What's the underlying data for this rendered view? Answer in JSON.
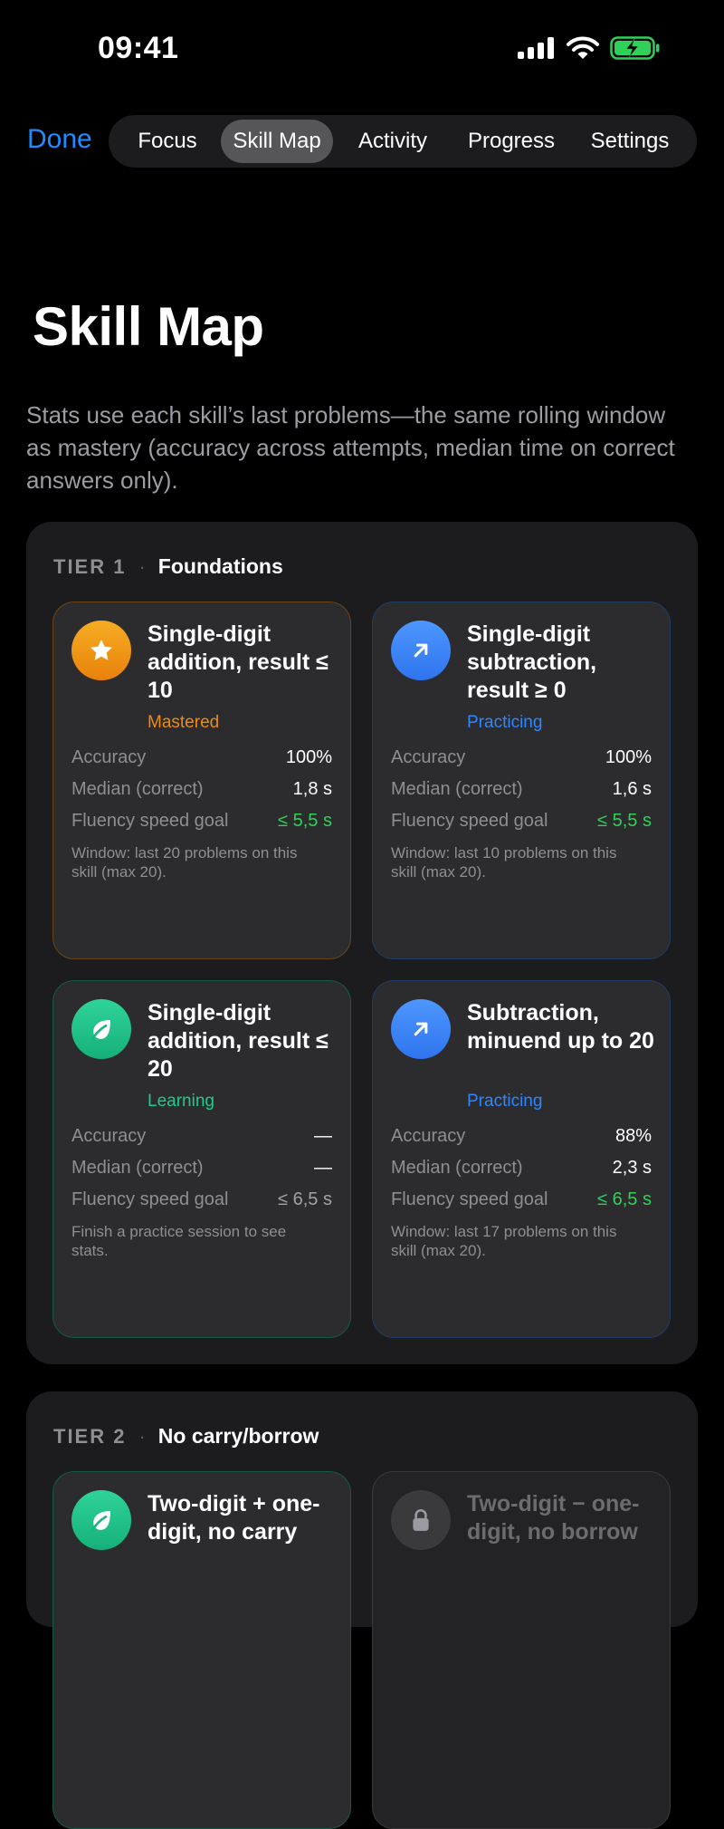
{
  "status_bar": {
    "time": "09:41"
  },
  "nav": {
    "done_label": "Done",
    "tabs": [
      {
        "label": "Focus",
        "active": false
      },
      {
        "label": "Skill Map",
        "active": true
      },
      {
        "label": "Activity",
        "active": false
      },
      {
        "label": "Progress",
        "active": false
      },
      {
        "label": "Settings",
        "active": false
      }
    ]
  },
  "page": {
    "title": "Skill Map",
    "intro": "Stats use each skill’s last problems—the same rolling window as mastery (accuracy across attempts, median time on correct answers only)."
  },
  "tiers": [
    {
      "label": "TIER 1",
      "separator": "·",
      "name": "Foundations",
      "skills": [
        {
          "title": "Single-digit addition, result ≤ 10",
          "status": "Mastered",
          "icon": "star-icon",
          "accuracy_label": "Accuracy",
          "accuracy": "100%",
          "median_label": "Median (correct)",
          "median": "1,8 s",
          "goal_label": "Fluency speed goal",
          "goal": "≤ 5,5 s",
          "note": "Window: last 20 problems on this skill (max 20)."
        },
        {
          "title": "Single-digit subtraction, result ≥ 0",
          "status": "Practicing",
          "icon": "arrow-up-right-icon",
          "accuracy_label": "Accuracy",
          "accuracy": "100%",
          "median_label": "Median (correct)",
          "median": "1,6 s",
          "goal_label": "Fluency speed goal",
          "goal": "≤ 5,5 s",
          "note": "Window: last 10 problems on this skill (max 20)."
        },
        {
          "title": "Single-digit addition, result ≤ 20",
          "status": "Learning",
          "icon": "leaf-icon",
          "accuracy_label": "Accuracy",
          "accuracy": "—",
          "median_label": "Median (correct)",
          "median": "—",
          "goal_label": "Fluency speed goal",
          "goal": "≤ 6,5 s",
          "note": "Finish a practice session to see stats."
        },
        {
          "title": "Subtraction, minuend up to 20",
          "status": "Practicing",
          "icon": "arrow-up-right-icon",
          "accuracy_label": "Accuracy",
          "accuracy": "88%",
          "median_label": "Median (correct)",
          "median": "2,3 s",
          "goal_label": "Fluency speed goal",
          "goal": "≤ 6,5 s",
          "note": "Window: last 17 problems on this skill (max 20)."
        }
      ]
    },
    {
      "label": "TIER 2",
      "separator": "·",
      "name": "No carry/borrow",
      "skills": [
        {
          "title": "Two-digit + one-digit, no carry",
          "status": "Learning",
          "icon": "leaf-icon"
        },
        {
          "title": "Two-digit − one-digit, no borrow",
          "status": "Locked",
          "icon": "lock-icon"
        }
      ]
    }
  ],
  "colors": {
    "accent": "#1e8cff",
    "mastered": "#f08a12",
    "practicing": "#2f86ff",
    "learning": "#1ecb8a",
    "goal_met": "#30d158",
    "battery": "#30d158"
  }
}
